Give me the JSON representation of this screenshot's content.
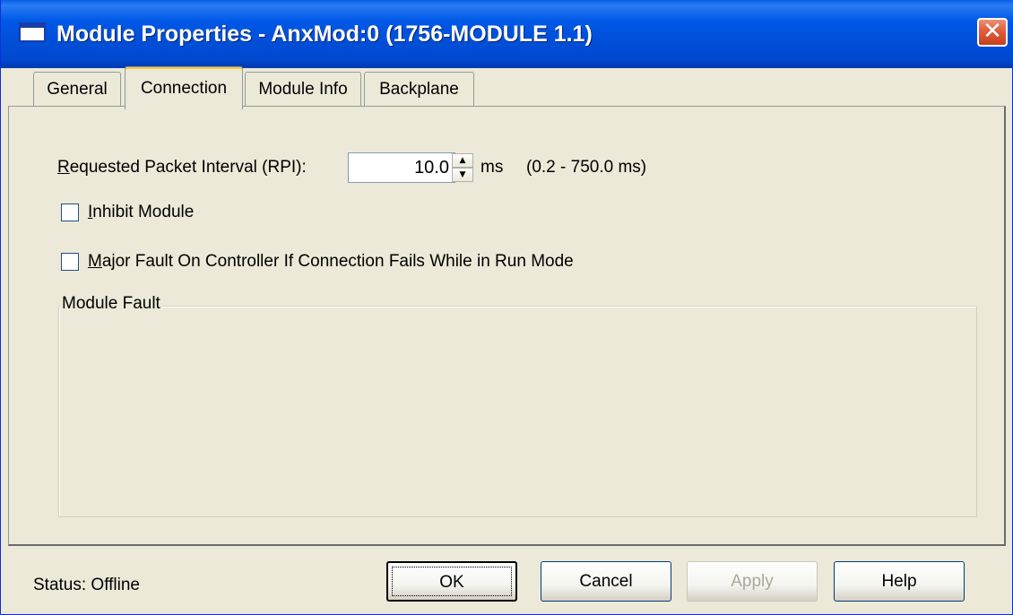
{
  "window": {
    "title": "Module Properties  - AnxMod:0 (1756-MODULE 1.1)",
    "close_glyph": "✕"
  },
  "tabs": [
    {
      "label": "General",
      "active": false
    },
    {
      "label": "Connection",
      "active": true
    },
    {
      "label": "Module Info",
      "active": false
    },
    {
      "label": "Backplane",
      "active": false
    }
  ],
  "connection": {
    "rpi_label_first": "R",
    "rpi_label_rest": "equested Packet Interval (RPI):",
    "rpi_value": "10.0",
    "rpi_unit": "ms",
    "rpi_range": "(0.2 - 750.0 ms)",
    "inhibit_first": "I",
    "inhibit_rest": "nhibit Module",
    "inhibit_checked": false,
    "major_fault_first": "M",
    "major_fault_rest": "ajor Fault On Controller If Connection Fails While in Run Mode",
    "major_fault_checked": false,
    "module_fault_legend": "Module Fault"
  },
  "footer": {
    "status_text": "Status:  Offline",
    "ok_label": "OK",
    "cancel_label": "Cancel",
    "apply_label": "Apply",
    "help_label": "Help"
  },
  "colors": {
    "titlebar": "#0058e6",
    "face": "#ece9d8",
    "active_tab_highlight": "#ffc83c",
    "disabled_text": "#aca899"
  }
}
